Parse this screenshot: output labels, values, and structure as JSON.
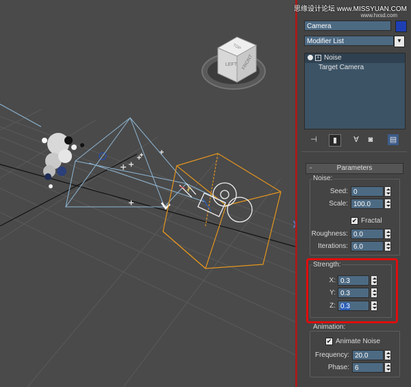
{
  "viewcube": {
    "faces": [
      "LEFT",
      "FRONT",
      "TOP"
    ]
  },
  "watermark": {
    "line1": "思缘设计论坛 www.MISSYUAN.COM",
    "line2": "www.hxsd.com"
  },
  "object": {
    "name": "Camera",
    "color": "#1e3fb3"
  },
  "modifier_list": {
    "label": "Modifier List"
  },
  "stack": {
    "items": [
      "Noise",
      "Target Camera"
    ]
  },
  "toolbar": {
    "icons": [
      "pin-stack-icon",
      "show-end-result-icon",
      "make-unique-icon",
      "remove-modifier-icon",
      "configure-modifier-sets-icon"
    ]
  },
  "parameters": {
    "title": "Parameters",
    "collapse": "-",
    "noise": {
      "group": "Noise:",
      "seed_label": "Seed:",
      "seed": "0",
      "scale_label": "Scale:",
      "scale": "100.0",
      "fractal_label": "Fractal",
      "fractal_checked": true,
      "roughness_label": "Roughness:",
      "roughness": "0.0",
      "iterations_label": "Iterations:",
      "iterations": "6.0"
    },
    "strength": {
      "group": "Strength:",
      "x_label": "X:",
      "x": "0.3",
      "y_label": "Y:",
      "y": "0.3",
      "z_label": "Z:",
      "z": "0.3"
    },
    "animation": {
      "group": "Animation:",
      "animate_label": "Animate Noise",
      "animate_checked": true,
      "frequency_label": "Frequency:",
      "frequency": "20.0",
      "phase_label": "Phase:",
      "phase": "6"
    }
  },
  "colors": {
    "highlight": "#e00d0d",
    "field": "#4d6a83",
    "selection": "#2b5fb8",
    "gizmo": "#e5961e",
    "frustum": "#8fb8d6"
  }
}
